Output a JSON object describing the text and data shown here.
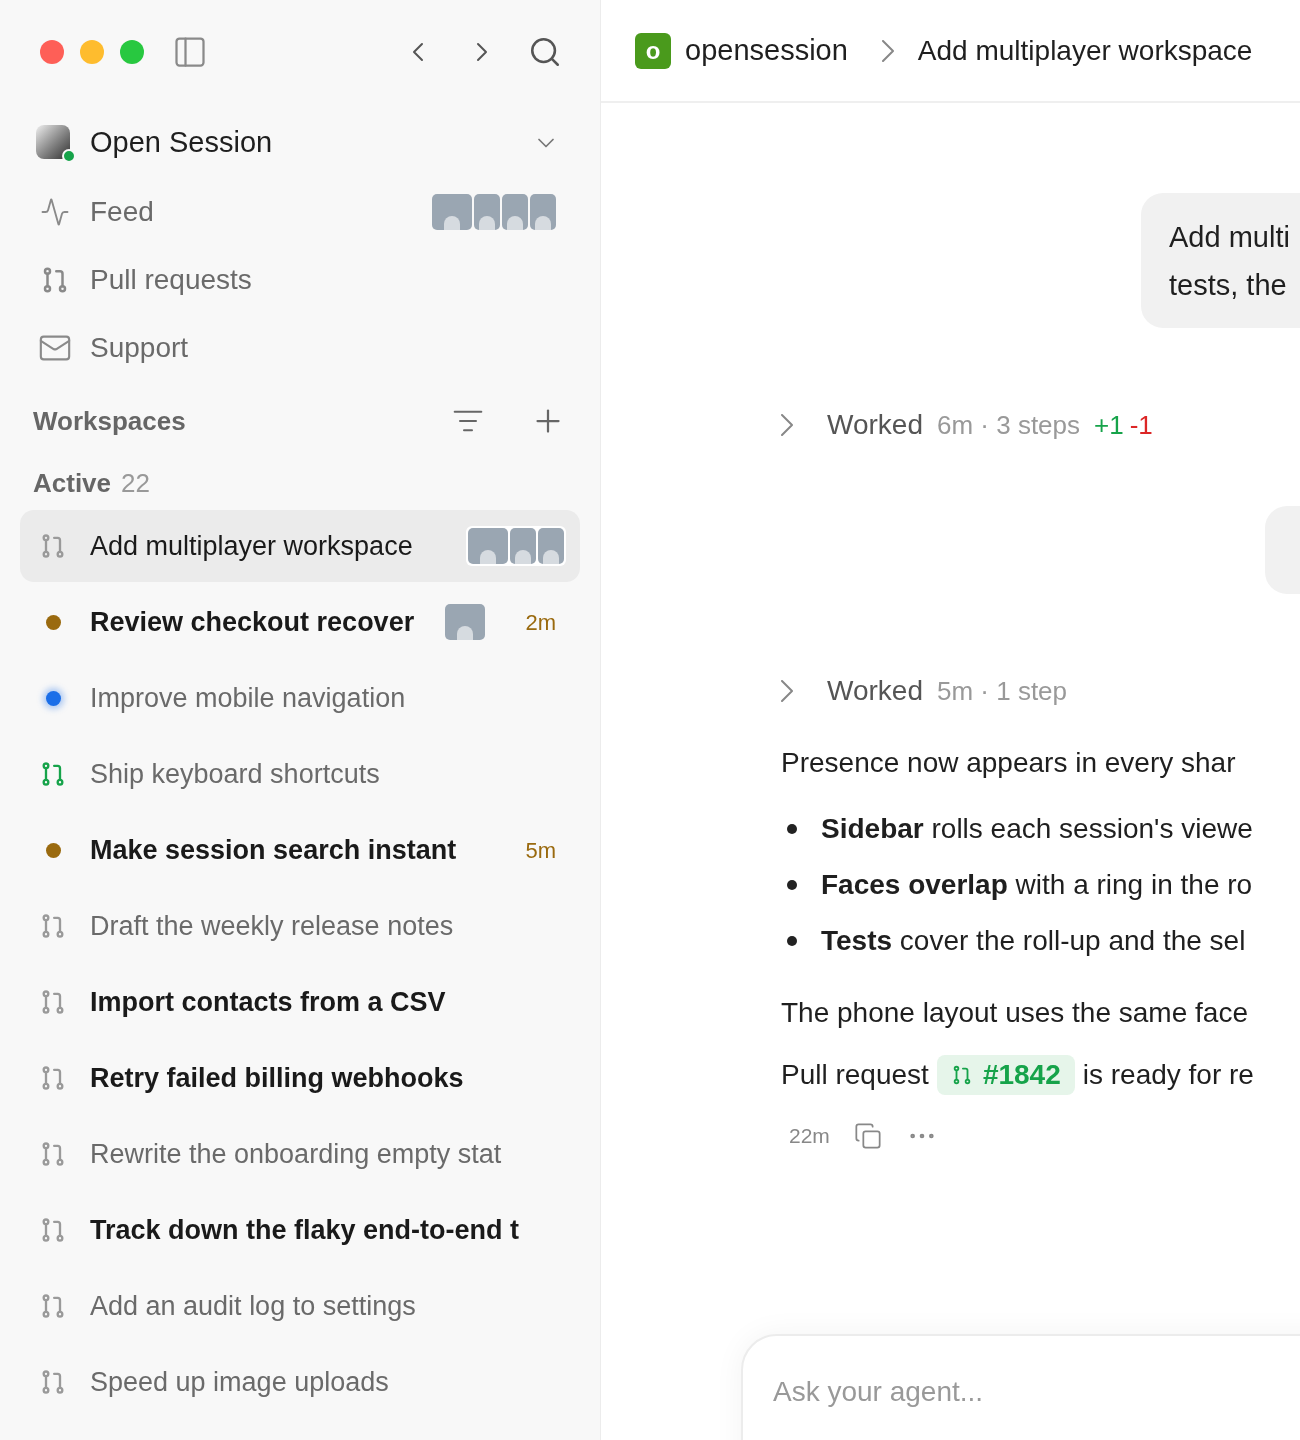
{
  "sidebar": {
    "workspace": {
      "name": "Open Session",
      "online": true
    },
    "nav": [
      {
        "kind": "feed",
        "label": "Feed",
        "avatars": [
          {
            "kind": "photo"
          },
          {
            "kind": "photo"
          },
          {
            "kind": "photo"
          },
          {
            "kind": "photo"
          }
        ]
      },
      {
        "kind": "pr",
        "label": "Pull requests"
      },
      {
        "kind": "mail",
        "label": "Support"
      }
    ],
    "section_title": "Workspaces",
    "group": {
      "label": "Active",
      "count": "22"
    },
    "items": [
      {
        "kind": "pr",
        "title": "Add multiplayer workspace",
        "selected": true,
        "unread": false,
        "avatars": [
          {
            "kind": "photo"
          },
          {
            "kind": "photo"
          },
          {
            "kind": "photo"
          }
        ]
      },
      {
        "kind": "dot",
        "color": "#9a6a0f",
        "title": "Review checkout recover",
        "selected": false,
        "unread": true,
        "avatars": [
          {
            "kind": "photo"
          }
        ],
        "time": "2m"
      },
      {
        "kind": "glow",
        "color": "#1a6ee8",
        "title": "Improve mobile navigation",
        "selected": false,
        "unread": false
      },
      {
        "kind": "pr-open",
        "title": "Ship keyboard shortcuts",
        "selected": false,
        "unread": false
      },
      {
        "kind": "dot",
        "color": "#9a6a0f",
        "title": "Make session search instant",
        "selected": false,
        "unread": true,
        "time": "5m"
      },
      {
        "kind": "pr",
        "title": "Draft the weekly release notes",
        "selected": false,
        "unread": false
      },
      {
        "kind": "pr",
        "title": "Import contacts from a CSV",
        "selected": false,
        "unread": true
      },
      {
        "kind": "pr",
        "title": "Retry failed billing webhooks",
        "selected": false,
        "unread": true
      },
      {
        "kind": "pr",
        "title": "Rewrite the onboarding empty stat",
        "selected": false,
        "unread": false
      },
      {
        "kind": "pr",
        "title": "Track down the flaky end-to-end t",
        "selected": false,
        "unread": true
      },
      {
        "kind": "pr",
        "title": "Add an audit log to settings",
        "selected": false,
        "unread": false
      },
      {
        "kind": "pr",
        "title": "Speed up image uploads",
        "selected": false,
        "unread": false
      }
    ]
  },
  "breadcrumb": {
    "repo_badge": "o",
    "repo": "opensession",
    "title": "Add multiplayer workspace"
  },
  "messages": [
    {
      "kind": "user",
      "lines": [
        "Add multi",
        "tests, the"
      ]
    },
    {
      "kind": "work",
      "label": "Worked",
      "meta": "6m · 3 steps",
      "added": "+1",
      "removed": "-1"
    },
    {
      "kind": "user-hidden"
    },
    {
      "kind": "work",
      "label": "Worked",
      "meta": "5m · 1 step"
    },
    {
      "kind": "text",
      "text": "Presence now appears in every shar"
    },
    {
      "kind": "bullets",
      "items": [
        "**Sidebar** rolls each session's viewe",
        "**Faces overlap** with a ring in the ro",
        "**Tests** cover the roll-up and the sel"
      ]
    },
    {
      "kind": "text",
      "text": "The phone layout uses the same face"
    },
    {
      "kind": "pr-line",
      "before": "Pull request",
      "pr": "#1842",
      "after": "is ready for re"
    },
    {
      "kind": "footer",
      "time": "22m"
    }
  ],
  "composer": {
    "placeholder": "Ask your agent..."
  }
}
